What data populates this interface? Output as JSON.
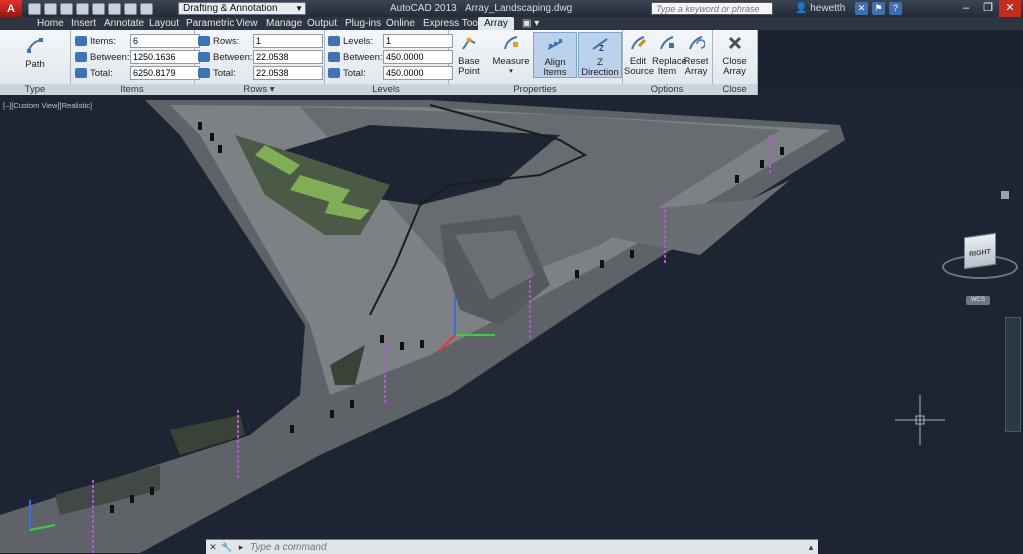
{
  "app": {
    "logo": "A",
    "title_app": "AutoCAD 2013",
    "title_file": "Array_Landscaping.dwg"
  },
  "workspace": {
    "value": "Drafting & Annotation"
  },
  "search": {
    "placeholder": "Type a keyword or phrase"
  },
  "user": {
    "name": "hewetth"
  },
  "tabs": [
    "Home",
    "Insert",
    "Annotate",
    "Layout",
    "Parametric",
    "View",
    "Manage",
    "Output",
    "Plug-ins",
    "Online",
    "Express Tools",
    "Array"
  ],
  "active_tab": "Array",
  "ribbon": {
    "type": {
      "path_label": "Path",
      "panel": "Type"
    },
    "items": {
      "panel": "Items",
      "items_label": "Items:",
      "items_value": "6",
      "between_label": "Between:",
      "between_value": "1250.1636",
      "total_label": "Total:",
      "total_value": "6250.8179"
    },
    "rows": {
      "panel": "Rows ▾",
      "rows_label": "Rows:",
      "rows_value": "1",
      "between_label": "Between:",
      "between_value": "22.0538",
      "total_label": "Total:",
      "total_value": "22.0538"
    },
    "levels": {
      "panel": "Levels",
      "levels_label": "Levels:",
      "levels_value": "1",
      "between_label": "Between:",
      "between_value": "450.0000",
      "total_label": "Total:",
      "total_value": "450.0000"
    },
    "properties": {
      "panel": "Properties",
      "base_point": "Base Point",
      "measure": "Measure",
      "align_items": "Align Items",
      "z_direction": "Z Direction"
    },
    "options": {
      "panel": "Options",
      "edit_source_1": "Edit",
      "edit_source_2": "Source",
      "replace_item_1": "Replace",
      "replace_item_2": "Item",
      "reset_array_1": "Reset",
      "reset_array_2": "Array"
    },
    "close": {
      "panel": "Close",
      "close_array": "Close Array"
    }
  },
  "viewport": {
    "label": "[–][Custom View][Realistic]",
    "viewcube_face": "RIGHT",
    "wcs": "WCS"
  },
  "command": {
    "placeholder": "Type a command"
  },
  "colors": {
    "accent": "#3f73b7",
    "viewport_bg": "#1d2533",
    "path_highlight": "#b455d8"
  }
}
